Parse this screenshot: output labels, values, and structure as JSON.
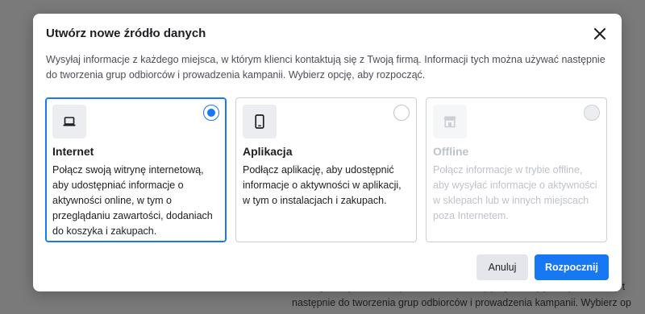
{
  "backdrop": {
    "lines": [
      "kazdego miejsca, w którym klienci kontaktują się z Twoją firmą. Informacji t",
      "następnie do tworzenia grup odbiorców i prowadzenia kampanii. Wybierz op"
    ]
  },
  "modal": {
    "title": "Utwórz nowe źródło danych",
    "description": "Wysyłaj informacje z każdego miejsca, w którym klienci kontaktują się z Twoją firmą. Informacji tych można używać następnie do tworzenia grup odbiorców i prowadzenia kampanii. Wybierz opcję, aby rozpocząć.",
    "options": [
      {
        "icon": "laptop-icon",
        "title": "Internet",
        "description": "Połącz swoją witrynę internetową, aby udostępniać informacje o aktywności online, w tym o przeglądaniu zawartości, dodaniach do koszyka i zakupach.",
        "selected": true,
        "disabled": false
      },
      {
        "icon": "smartphone-icon",
        "title": "Aplikacja",
        "description": "Podłącz aplikację, aby udostępnić informacje o aktywności w aplikacji, w tym o instalacjach i zakupach.",
        "selected": false,
        "disabled": false
      },
      {
        "icon": "store-icon",
        "title": "Offline",
        "description": "Połącz informacje w trybie offline, aby wysyłać informacje o aktywności w sklepach lub w innych miejscach poza Internetem.",
        "selected": false,
        "disabled": true
      }
    ],
    "buttons": {
      "cancel": "Anuluj",
      "start": "Rozpocznij"
    }
  },
  "colors": {
    "accent": "#1877f2",
    "overlay": "#7a7a7a",
    "disabled_text": "#bec3c9"
  }
}
